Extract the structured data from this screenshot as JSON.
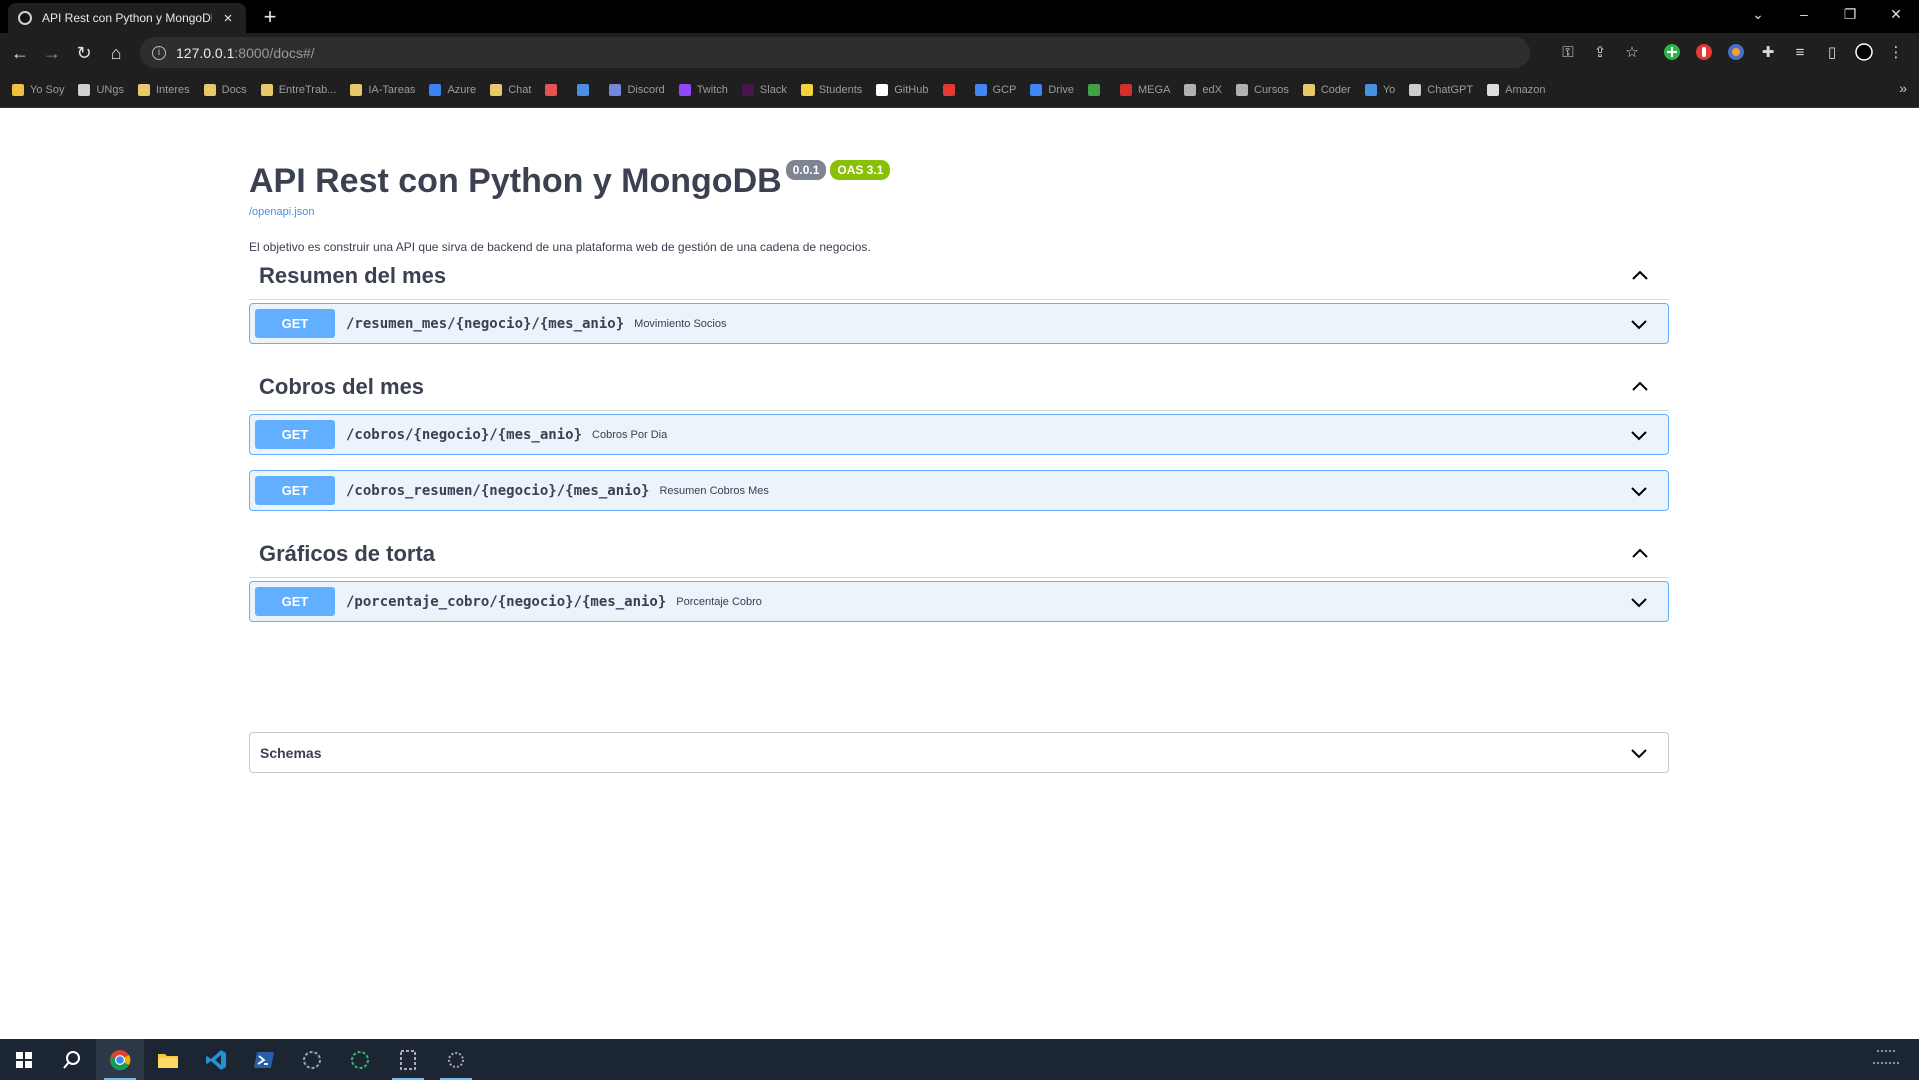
{
  "browser": {
    "tab_title": "API Rest con Python y MongoDB",
    "tab_close": "×",
    "new_tab": "+",
    "url_host": "127.0.0.1",
    "url_path": ":8000/docs#/",
    "bookmarks": [
      {
        "label": "Yo Soy",
        "color": "#f0c040"
      },
      {
        "label": "UNgs",
        "color": "#d0d0d0"
      },
      {
        "label": "Interes",
        "color": "#e8c86a"
      },
      {
        "label": "Docs",
        "color": "#e8c86a"
      },
      {
        "label": "EntreTrab...",
        "color": "#e8c86a"
      },
      {
        "label": "IA-Tareas",
        "color": "#e8c86a"
      },
      {
        "label": "Azure",
        "color": "#3b82f6"
      },
      {
        "label": "Chat",
        "color": "#e8c86a"
      },
      {
        "label": "",
        "color": "#e55353"
      },
      {
        "label": "",
        "color": "#4a90e2"
      },
      {
        "label": "Discord",
        "color": "#7289da"
      },
      {
        "label": "Twitch",
        "color": "#9146ff"
      },
      {
        "label": "Slack",
        "color": "#4a154b"
      },
      {
        "label": "Students",
        "color": "#f5d23b"
      },
      {
        "label": "GitHub",
        "color": "#ffffff"
      },
      {
        "label": "",
        "color": "#e53935"
      },
      {
        "label": "GCP",
        "color": "#4285f4"
      },
      {
        "label": "Drive",
        "color": "#4285f4"
      },
      {
        "label": "",
        "color": "#43a047"
      },
      {
        "label": "MEGA",
        "color": "#d32f2f"
      },
      {
        "label": "edX",
        "color": "#b0b0b0"
      },
      {
        "label": "Cursos",
        "color": "#b0b0b0"
      },
      {
        "label": "Coder",
        "color": "#e8c86a"
      },
      {
        "label": "Yo",
        "color": "#4a90e2"
      },
      {
        "label": "ChatGPT",
        "color": "#cccccc"
      },
      {
        "label": "Amazon",
        "color": "#dddddd"
      }
    ]
  },
  "info": {
    "title": "API Rest con Python y MongoDB",
    "version": "0.0.1",
    "oas": "OAS 3.1",
    "openapi_link": "/openapi.json",
    "description": "El objetivo es construir una API que sirva de backend de una plataforma web de gestión de una cadena de negocios."
  },
  "sections": [
    {
      "title": "Resumen del mes",
      "ops": [
        {
          "method": "GET",
          "path": "/resumen_mes/{negocio}/{mes_anio}",
          "summary": "Movimiento Socios"
        }
      ]
    },
    {
      "title": "Cobros del mes",
      "ops": [
        {
          "method": "GET",
          "path": "/cobros/{negocio}/{mes_anio}",
          "summary": "Cobros Por Dia"
        },
        {
          "method": "GET",
          "path": "/cobros_resumen/{negocio}/{mes_anio}",
          "summary": "Resumen Cobros Mes"
        }
      ]
    },
    {
      "title": "Gráficos de torta",
      "ops": [
        {
          "method": "GET",
          "path": "/porcentaje_cobro/{negocio}/{mes_anio}",
          "summary": "Porcentaje Cobro"
        }
      ]
    }
  ],
  "schemas": {
    "title": "Schemas"
  },
  "colors": {
    "get_method": "#61affe",
    "get_bg": "#ebf3fb",
    "oas_badge": "#89bf04",
    "version_badge": "#7d8492",
    "title": "#3b4151"
  }
}
